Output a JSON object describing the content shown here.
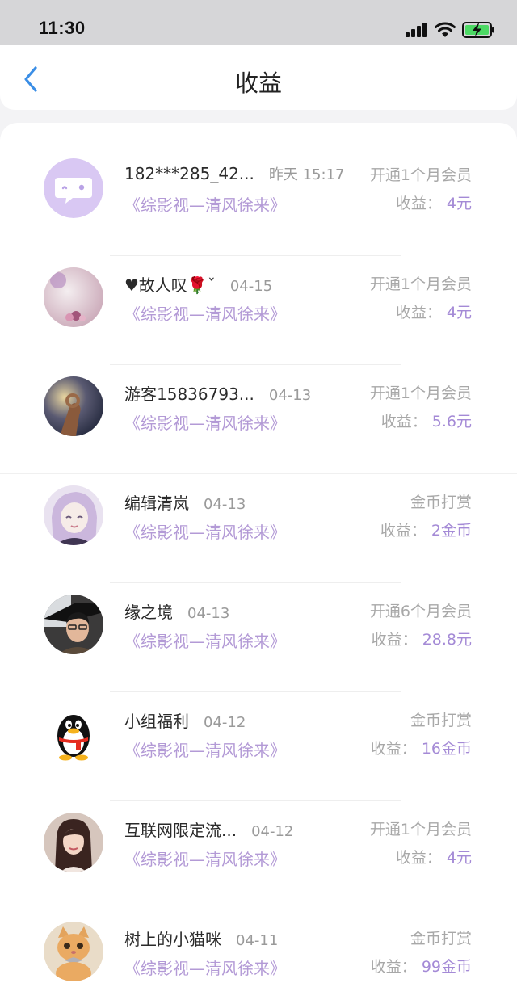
{
  "status": {
    "time": "11:30"
  },
  "header": {
    "title": "收益",
    "back_icon": "chevron-left-icon"
  },
  "colors": {
    "accent": "#a48ad6",
    "book_title": "#b39ad6",
    "back_arrow": "#3a8ee6"
  },
  "income_label": "收益：",
  "records": [
    {
      "name": "182***285_42...",
      "date": "昨天 15:17",
      "book": "《综影视—清风徐来》",
      "type": "开通1个月会员",
      "amount": "4元"
    },
    {
      "name": "♥故人叹🌹ˇ",
      "date": "04-15",
      "book": "《综影视—清风徐来》",
      "type": "开通1个月会员",
      "amount": "4元"
    },
    {
      "name": "游客15836793...",
      "date": "04-13",
      "book": "《综影视—清风徐来》",
      "type": "开通1个月会员",
      "amount": "5.6元"
    },
    {
      "name": "编辑清岚",
      "date": "04-13",
      "book": "《综影视—清风徐来》",
      "type": "金币打赏",
      "amount": "2金币"
    },
    {
      "name": "缘之境",
      "date": "04-13",
      "book": "《综影视—清风徐来》",
      "type": "开通6个月会员",
      "amount": "28.8元"
    },
    {
      "name": "小组福利",
      "date": "04-12",
      "book": "《综影视—清风徐来》",
      "type": "金币打赏",
      "amount": "16金币"
    },
    {
      "name": "互联网限定流...",
      "date": "04-12",
      "book": "《综影视—清风徐来》",
      "type": "开通1个月会员",
      "amount": "4元"
    },
    {
      "name": "树上的小猫咪",
      "date": "04-11",
      "book": "《综影视—清风徐来》",
      "type": "金币打赏",
      "amount": "99金币"
    }
  ]
}
